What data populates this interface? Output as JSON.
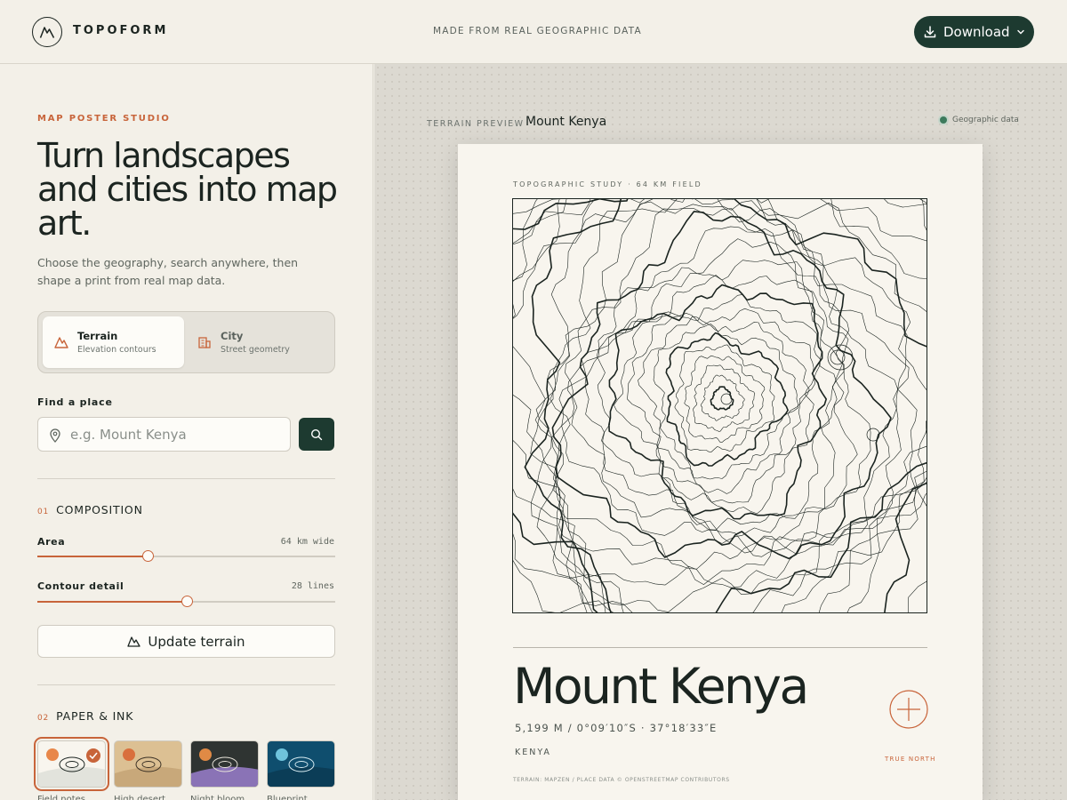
{
  "header": {
    "brand": "TOPOFORM",
    "tagline": "MADE FROM REAL GEOGRAPHIC DATA",
    "download_label": "Download"
  },
  "sidebar": {
    "eyebrow": "MAP POSTER STUDIO",
    "headline": "Turn landscapes and cities into map art.",
    "lede": "Choose the geography, search anywhere, then shape a print from real map data.",
    "modes": [
      {
        "title": "Terrain",
        "subtitle": "Elevation contours",
        "active": true
      },
      {
        "title": "City",
        "subtitle": "Street geometry",
        "active": false
      }
    ],
    "find_label": "Find a place",
    "search": {
      "placeholder": "e.g. Mount Kenya",
      "value": ""
    },
    "composition": {
      "number": "01",
      "title": "COMPOSITION",
      "area": {
        "label": "Area",
        "value_text": "64 km wide",
        "fraction": 0.37
      },
      "detail": {
        "label": "Contour detail",
        "value_text": "28 lines",
        "fraction": 0.5
      }
    },
    "update_label": "Update terrain",
    "paper": {
      "number": "02",
      "title": "PAPER & INK",
      "swatches": [
        {
          "name": "Field notes",
          "bg": "#f8f5ee",
          "land": "#e2e3dc",
          "sun": "#e8874a",
          "ink": "#1b2420",
          "selected": true
        },
        {
          "name": "High desert",
          "bg": "#dcc093",
          "land": "#c8a87a",
          "sun": "#d96f3d",
          "ink": "#3a3024",
          "selected": false
        },
        {
          "name": "Night bloom",
          "bg": "#2f3432",
          "land": "#8a73b6",
          "sun": "#e08a45",
          "ink": "#e8e4da",
          "selected": false
        },
        {
          "name": "Blueprint",
          "bg": "#0f4e6e",
          "land": "#0b3d57",
          "sun": "#6fc3dc",
          "ink": "#d8ecf2",
          "selected": false
        }
      ]
    }
  },
  "preview": {
    "label": "TERRAIN PREVIEW",
    "place": "Mount Kenya",
    "badge": "Geographic data"
  },
  "poster": {
    "kicker": "TOPOGRAPHIC STUDY · 64 KM FIELD",
    "title": "Mount Kenya",
    "coords": "5,199 M / 0°09′10″S · 37°18′33″E",
    "country": "KENYA",
    "true_north": "TRUE NORTH",
    "credit": "TERRAIN: MAPZEN / PLACE DATA © OPENSTREETMAP CONTRIBUTORS"
  },
  "colors": {
    "accent": "#c8643a",
    "dark": "#1d3a30",
    "ink": "#1b2420"
  }
}
